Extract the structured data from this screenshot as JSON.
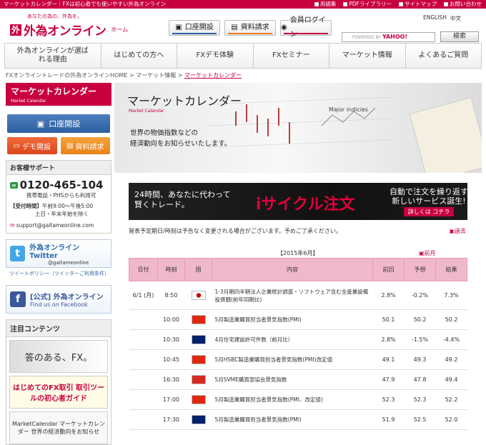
{
  "topbar": {
    "text": "マーケットカレンダー｜FXは初心者でも使いやすい外為オンライン",
    "links": [
      "用語集",
      "PDFライブラリー",
      "サイトマップ",
      "お問い合わせ"
    ]
  },
  "header": {
    "tagline": "あなたの為の、外為を。",
    "logo": "外為オンライン",
    "home": "ホーム",
    "btn_open": "口座開設",
    "btn_docs": "資料請求",
    "btn_login": "会員ログイン",
    "lang_en": "ENGLISH",
    "lang_zh": "中文",
    "search_placeholder": "POWERED BY",
    "search_brand": "YAHOO!",
    "search_btn": "検索"
  },
  "nav": [
    "外為オンラインが選ばれる理由",
    "はじめての方へ",
    "FXデモ体験",
    "FXセミナー",
    "マーケット情報",
    "よくあるご質問"
  ],
  "breadcrumb": {
    "home": "FXオンライントレードの外為オンラインHOME",
    "sep": " > ",
    "market": "マーケット情報",
    "current": "マーケットカレンダー"
  },
  "sidebar": {
    "title": "マーケットカレンダー",
    "subtitle": "Market Calendar",
    "open": "口座開設",
    "demo": "デモ開設",
    "docs": "資料請求",
    "support_title": "お客様サポート",
    "tel": "0120-465-104",
    "tel_note": "携帯電話・PHSからも利用可",
    "hours_label": "【受付時間】",
    "hours": "午前9:00〜午後5:00",
    "hours_note": "土日・年末年始を除く",
    "email": "support@gaitameonline.com",
    "twitter": "外為オンライン Twitter",
    "twitter_id": "@gaitameonline",
    "tw_policy": "ツイートポリシー（ツイッターご利用条件）",
    "fb": "[公式] 外為オンライン",
    "fb_sub": "Find us on Facebook",
    "attn_title": "注目コンテンツ",
    "b1": "答のある、FX。",
    "b2": "はじめてのFX取引 取引ツールの初心者ガイド",
    "b3": "MarketCalendar マーケットカレンダー 世界の経済動向をお知らせ"
  },
  "hero": {
    "title": "マーケットカレンダー",
    "sub": "Market Calendar",
    "desc1": "世界の物価指数などの",
    "desc2": "経済動向をお知らせいたします。"
  },
  "ad": {
    "left1": "24時間、あなたに代わって",
    "left2": "賢くトレード。",
    "center": "iサイクル注文",
    "right1": "自動で注文を繰り返す",
    "right2": "新しいサービス誕生!",
    "right3": "詳しくは コチラ"
  },
  "notice": "発表予定期日/時刻は予告なく変更される場合がございます。予めご了承ください。",
  "past": "過去",
  "month": "【2015年6月】",
  "prev": "前月",
  "table": {
    "headers": [
      "日付",
      "時刻",
      "国",
      "内容",
      "前回",
      "予想",
      "結果"
    ],
    "rows": [
      {
        "date": "6/1 (月)",
        "time": "8:50",
        "flag": "#fff",
        "dot": "#c00",
        "event": "1-3月期四半期法人企業統計調査・ソフトウェア含む全産業設備投資額(前年同期比)",
        "prev": "2.8%",
        "fcst": "-0.2%",
        "result": "7.3%"
      },
      {
        "date": "",
        "time": "10:00",
        "flag": "#de2910",
        "dot": "",
        "event": "5月製造業購買担当者景気指数(PMI)",
        "prev": "50.1",
        "fcst": "50.2",
        "result": "50.2"
      },
      {
        "date": "",
        "time": "10:30",
        "flag": "#012169",
        "dot": "",
        "event": "4月住宅建設許可件数（前月比）",
        "prev": "2.8%",
        "fcst": "-1.5%",
        "result": "-4.4%"
      },
      {
        "date": "",
        "time": "10:45",
        "flag": "#de2910",
        "dot": "",
        "event": "5月HSBC製造業購買担当者景気指数(PMI)改定値",
        "prev": "49.1",
        "fcst": "49.3",
        "result": "49.2"
      },
      {
        "date": "",
        "time": "16:30",
        "flag": "#d52b1e",
        "dot": "",
        "event": "5月SVME購買部協会景気指数",
        "prev": "47.9",
        "fcst": "47.8",
        "result": "49.4"
      },
      {
        "date": "",
        "time": "17:00",
        "flag": "#de2910",
        "dot": "",
        "event": "5月製造業購買担当者景気指数(PMI、改定値)",
        "prev": "52.3",
        "fcst": "52.3",
        "result": "52.2"
      },
      {
        "date": "",
        "time": "17:30",
        "flag": "#012169",
        "dot": "",
        "event": "5月製造業購買担当者景気指数(PMI)",
        "prev": "51.9",
        "fcst": "52.5",
        "result": "52.0"
      }
    ]
  }
}
